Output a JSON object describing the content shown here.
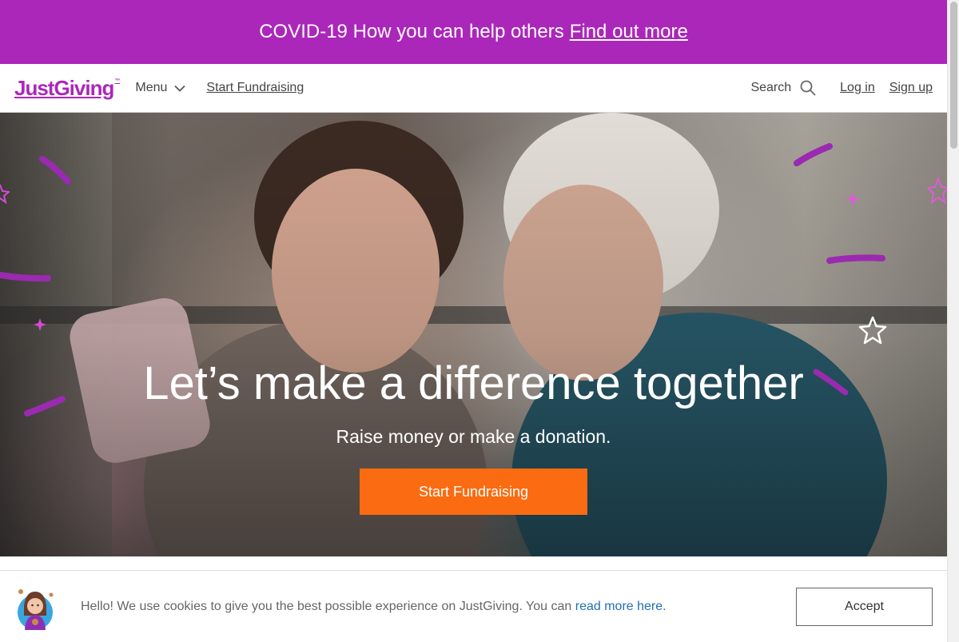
{
  "banner": {
    "text": "COVID-19 How you can help others",
    "link": "Find out more"
  },
  "nav": {
    "logo": "JustGiving",
    "logo_tm": "™",
    "menu": "Menu",
    "start_fundraising": "Start Fundraising",
    "search": "Search",
    "login": "Log in",
    "signup": "Sign up"
  },
  "hero": {
    "title": "Let’s make a difference together",
    "subtitle": "Raise money or make a donation.",
    "cta": "Start Fundraising"
  },
  "cookie": {
    "text": "Hello! We use cookies to give you the best possible experience on JustGiving. You can",
    "link": "read more here",
    "period": ".",
    "accept": "Accept"
  },
  "colors": {
    "brand_purple": "#ab27ba",
    "cta_orange": "#fb6b11",
    "link_blue": "#1f6fb5"
  },
  "icons": [
    "chevron-down-icon",
    "search-icon",
    "star-icon",
    "sparkle-icon",
    "cookie-mascot-icon"
  ]
}
